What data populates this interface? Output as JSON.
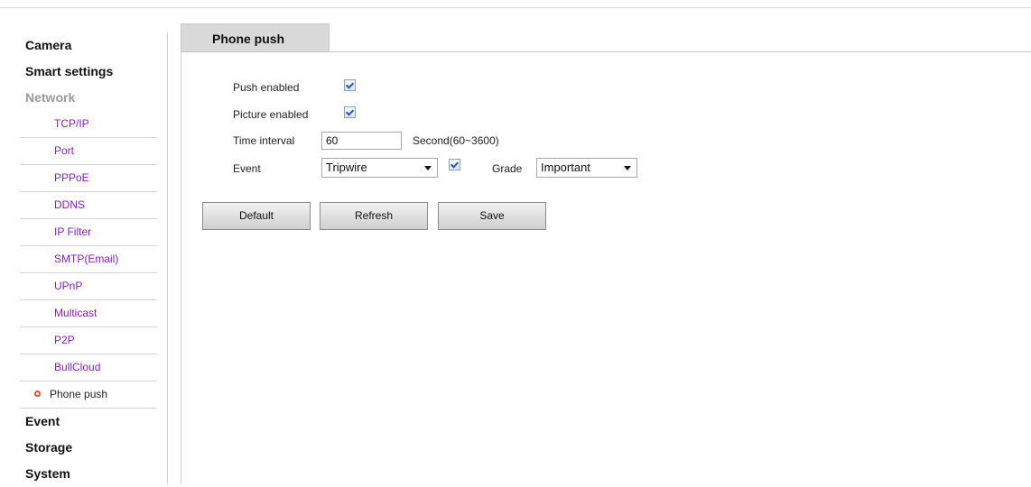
{
  "sidebar": {
    "sections": [
      {
        "label": "Camera"
      },
      {
        "label": "Smart settings"
      },
      {
        "label": "Network"
      }
    ],
    "network_items": [
      {
        "label": "TCP/IP"
      },
      {
        "label": "Port"
      },
      {
        "label": "PPPoE"
      },
      {
        "label": "DDNS"
      },
      {
        "label": "IP Filter"
      },
      {
        "label": "SMTP(Email)"
      },
      {
        "label": "UPnP"
      },
      {
        "label": "Multicast"
      },
      {
        "label": "P2P"
      },
      {
        "label": "BullCloud"
      },
      {
        "label": "Phone push"
      }
    ],
    "bottom_sections": [
      {
        "label": "Event"
      },
      {
        "label": "Storage"
      },
      {
        "label": "System"
      }
    ]
  },
  "tab": {
    "label": "Phone push"
  },
  "form": {
    "push_enabled": {
      "label": "Push enabled",
      "checked": true
    },
    "picture_enabled": {
      "label": "Picture enabled",
      "checked": true
    },
    "time_interval": {
      "label": "Time interval",
      "value": "60",
      "hint": "Second(60~3600)"
    },
    "event": {
      "label": "Event",
      "selected": "Tripwire",
      "checked": true
    },
    "grade": {
      "label": "Grade",
      "selected": "Important"
    }
  },
  "buttons": {
    "default": "Default",
    "refresh": "Refresh",
    "save": "Save"
  },
  "colors": {
    "link": "#8a1bc4",
    "active_dot": "#e2502f",
    "tab_bg": "#d9d9d9"
  }
}
